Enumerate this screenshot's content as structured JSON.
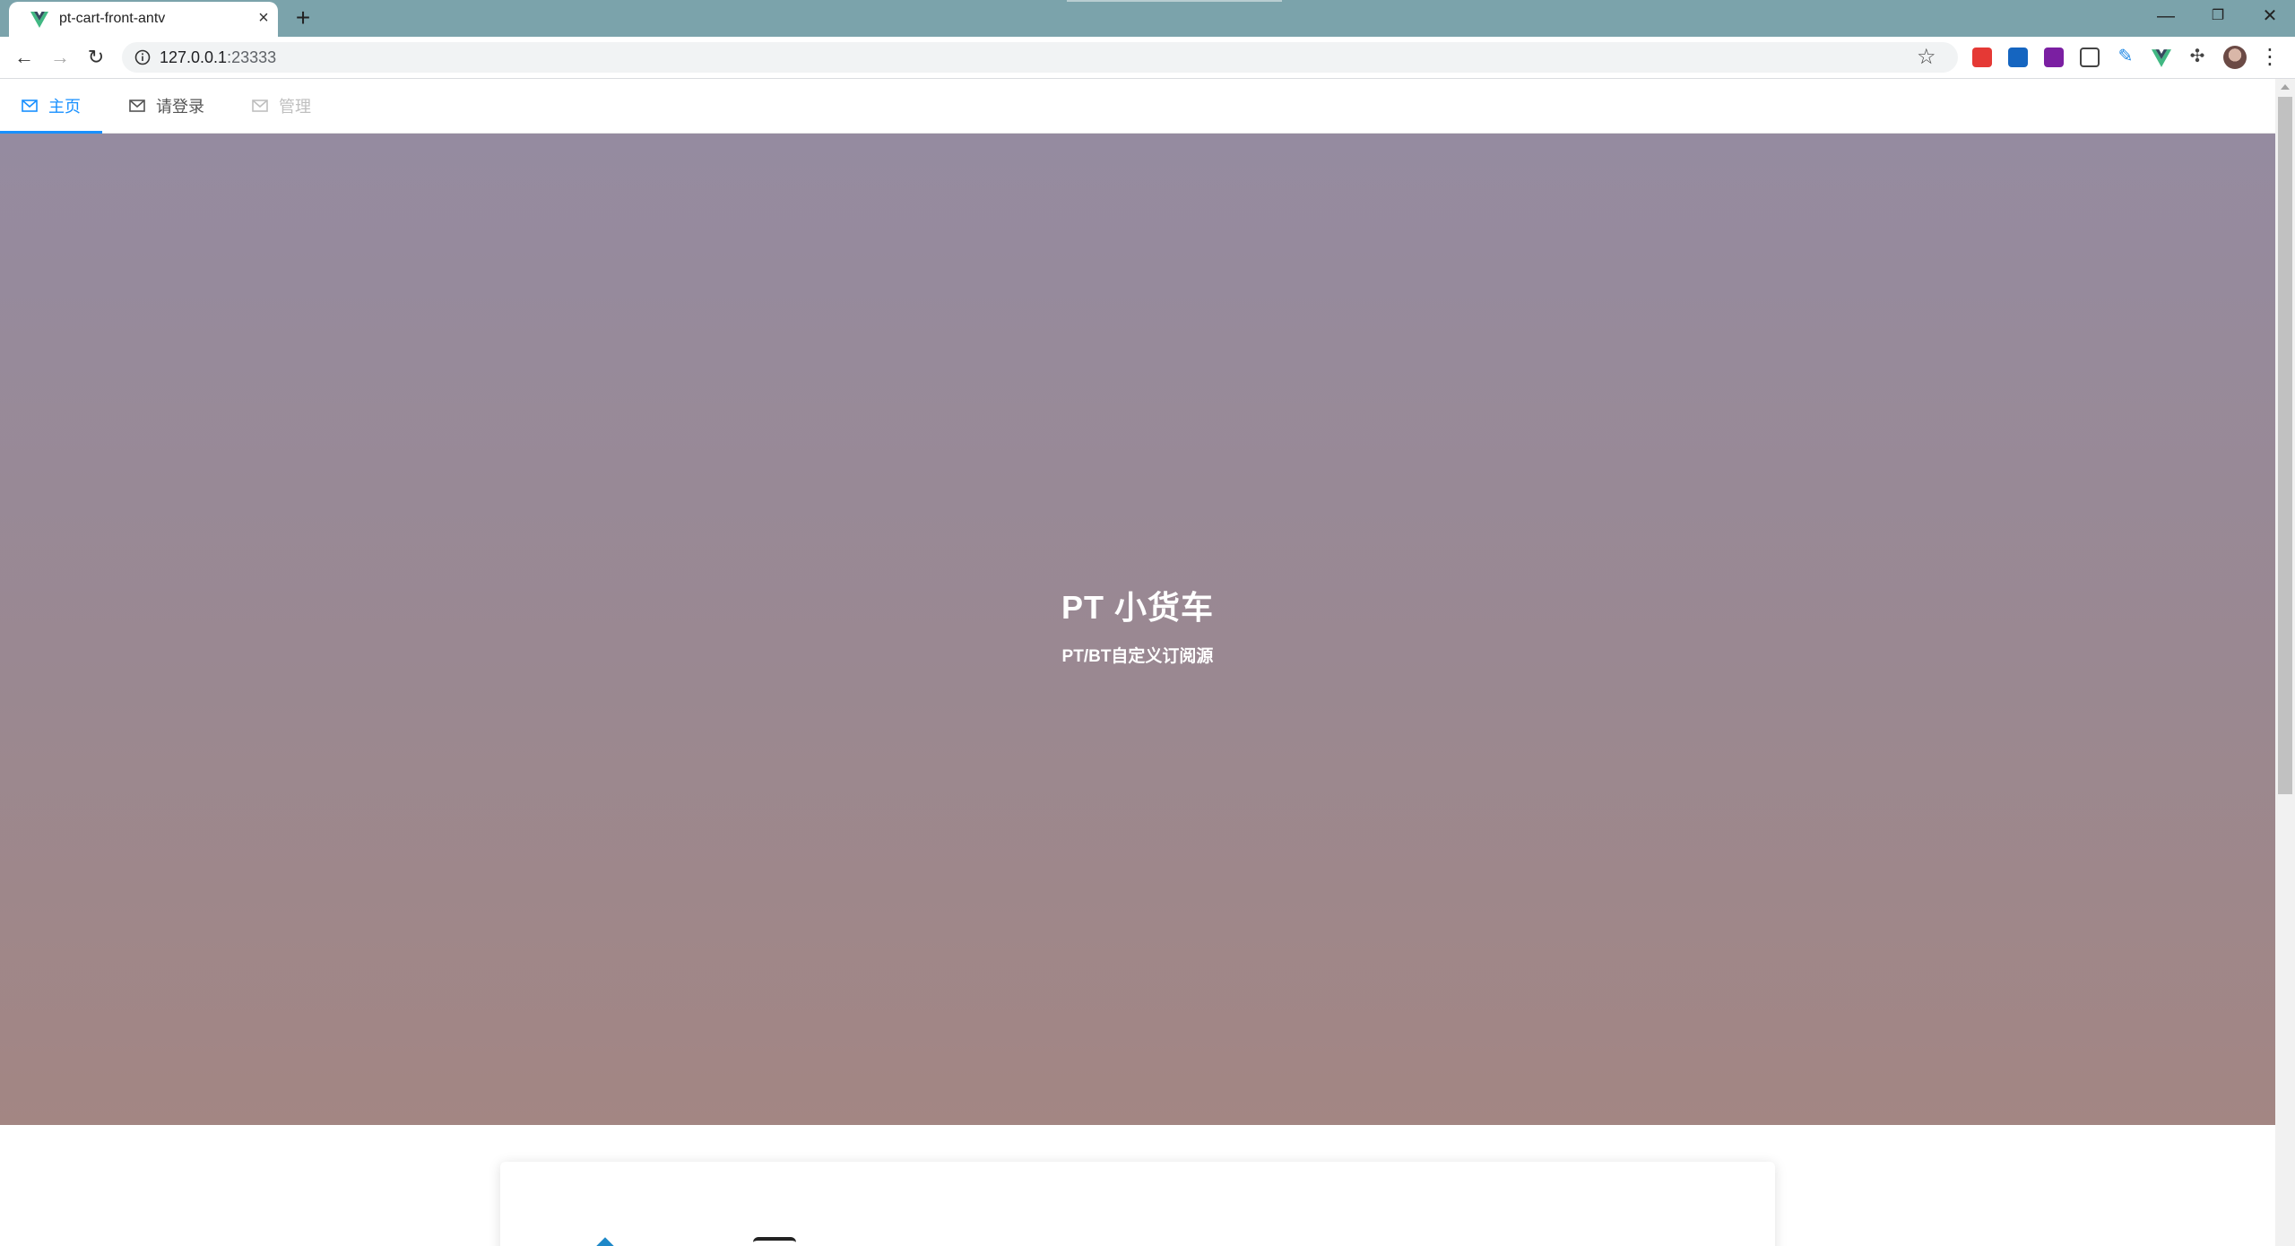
{
  "browser": {
    "tab_title": "pt-cart-front-antv",
    "tab_close_glyph": "×",
    "new_tab_glyph": "+",
    "url_host": "127.0.0.1",
    "url_port": ":23333",
    "window_controls": {
      "minimize": "—",
      "restore": "❐",
      "close": "✕"
    },
    "nav": {
      "back": "←",
      "forward": "→",
      "reload": "↻"
    },
    "extensions": [
      "red-extension-icon",
      "blue-extension-icon",
      "purple-extension-icon",
      "reader-extension-icon",
      "pen-extension-icon",
      "vue-devtools-icon",
      "puzzle-icon"
    ],
    "colors": {
      "tabstrip": "#7ba3ab",
      "omnibox": "#f1f3f4"
    }
  },
  "menu": {
    "items": [
      {
        "label": "主页",
        "state": "active"
      },
      {
        "label": "请登录",
        "state": "normal"
      },
      {
        "label": "管理",
        "state": "disabled"
      }
    ],
    "accent": "#1890ff"
  },
  "hero": {
    "title": "PT 小货车",
    "subtitle": "PT/BT自定义订阅源"
  },
  "card": {
    "icon": "cube-icon"
  }
}
